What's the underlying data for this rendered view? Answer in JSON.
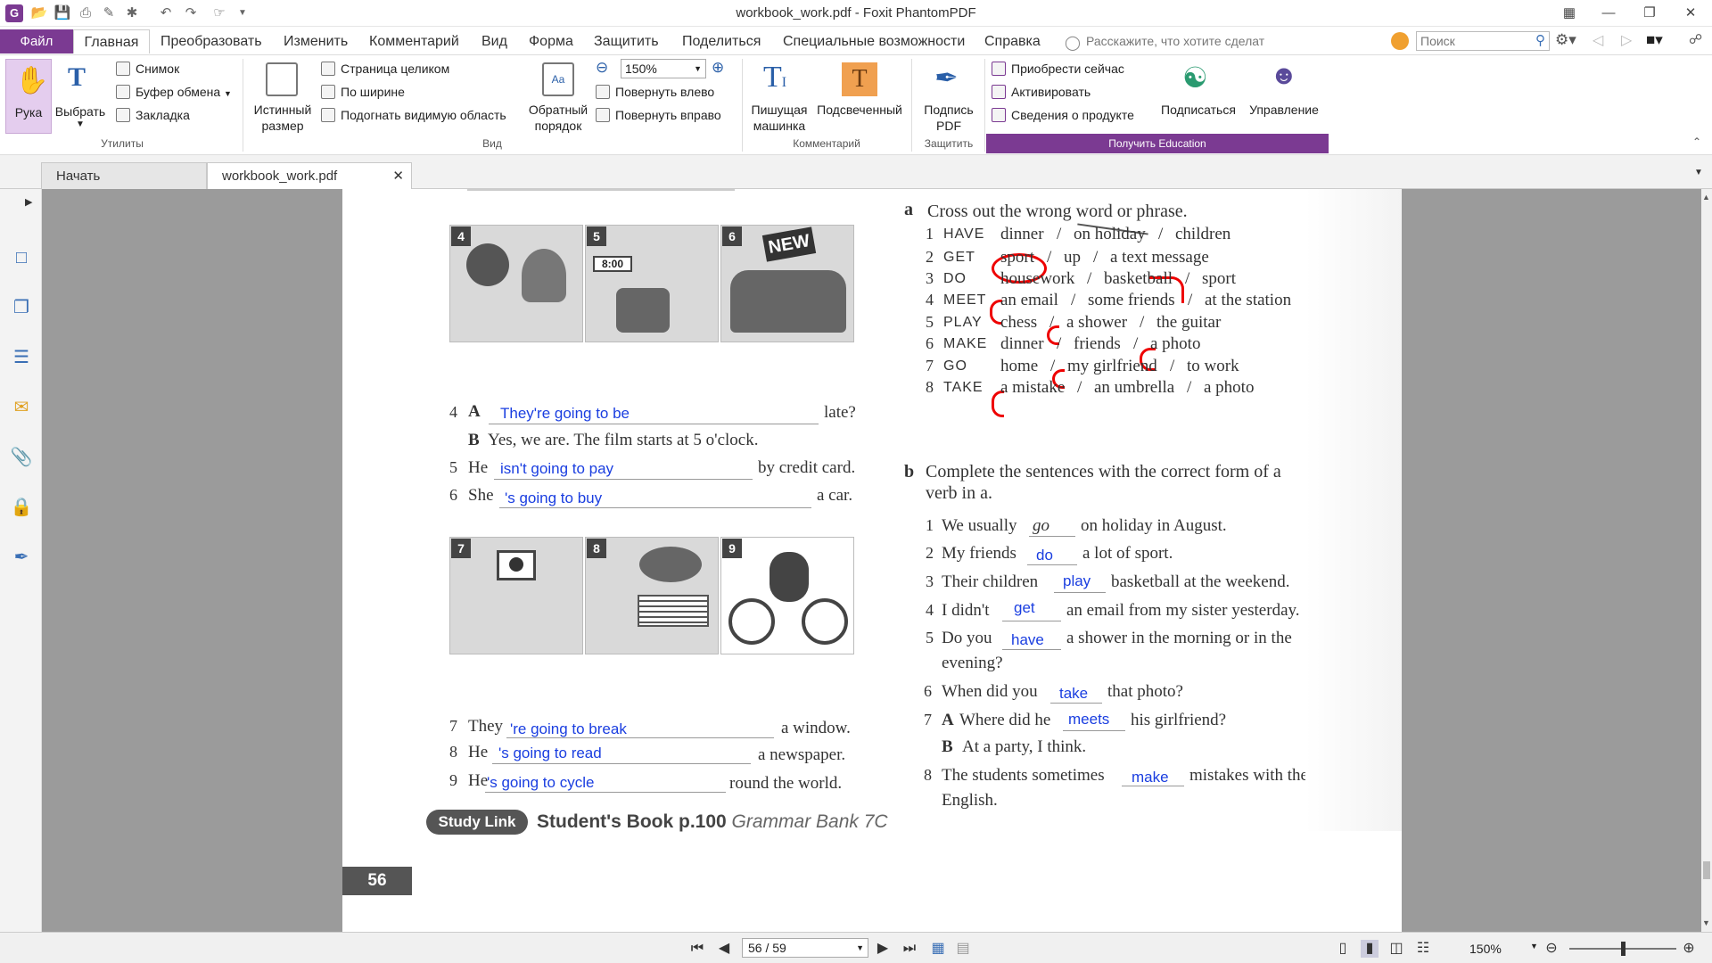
{
  "window": {
    "title": "workbook_work.pdf - Foxit PhantomPDF"
  },
  "menu": {
    "file": "Файл",
    "tabs": [
      "Главная",
      "Преобразовать",
      "Изменить",
      "Комментарий",
      "Вид",
      "Форма",
      "Защитить",
      "Поделиться",
      "Специальные возможности",
      "Справка"
    ],
    "tell_me": "Расскажите, что хотите сделат",
    "search_placeholder": "Поиск"
  },
  "ribbon": {
    "hand": "Рука",
    "select": "Выбрать",
    "snapshot": "Снимок",
    "clipboard": "Буфер обмена",
    "bookmark": "Закладка",
    "group_utilities": "Утилиты",
    "actual_size_1": "Истинный",
    "actual_size_2": "размер",
    "fit_page": "Страница целиком",
    "fit_width": "По ширине",
    "fit_visible": "Подогнать видимую область",
    "reverse_1": "Обратный",
    "reverse_2": "порядок",
    "zoom_value": "150%",
    "rotate_left": "Повернуть влево",
    "rotate_right": "Повернуть вправо",
    "group_view": "Вид",
    "typewriter_1": "Пишущая",
    "typewriter_2": "машинка",
    "highlight": "Подсвеченный",
    "group_comment": "Комментарий",
    "sign_1": "Подпись",
    "sign_2": "PDF",
    "group_protect": "Защитить",
    "buy_now": "Приобрести сейчас",
    "activate": "Активировать",
    "product_info": "Сведения о продукте",
    "subscribe": "Подписаться",
    "manage": "Управление",
    "get_education": "Получить Education"
  },
  "tabs": {
    "start": "Начать",
    "doc": "workbook_work.pdf"
  },
  "page": {
    "left": {
      "pic_numbers": [
        "4",
        "5",
        "6",
        "7",
        "8",
        "9"
      ],
      "clock": "8:00",
      "new_sign": "NEW",
      "line4": {
        "num": "4",
        "a": "A",
        "answer": "They're going to be",
        "end": "late?"
      },
      "line4b": {
        "b": "B",
        "text": "Yes, we are. The film starts at 5 o'clock."
      },
      "line5": {
        "num": "5",
        "start": "He",
        "answer": "isn't going to pay",
        "end": "by credit card."
      },
      "line6": {
        "num": "6",
        "start": "She",
        "answer": "'s going to buy",
        "end": "a car."
      },
      "line7": {
        "num": "7",
        "start": "They",
        "answer": "'re going to break",
        "end": "a window."
      },
      "line8": {
        "num": "8",
        "start": "He",
        "answer": "'s going to read",
        "end": "a newspaper."
      },
      "line9": {
        "num": "9",
        "start": "He",
        "answer": "'s going to cycle",
        "end": "round the world."
      },
      "study_link": "Study Link",
      "study_ref_bold": "Student's Book p.100",
      "study_ref_italic": "Grammar Bank 7C",
      "page_number": "56"
    },
    "right": {
      "a_letter": "a",
      "a_title": "Cross out the wrong word or phrase.",
      "rows": [
        {
          "n": "1",
          "verb": "HAVE",
          "w1": "dinner",
          "w2": "on holiday",
          "w3": "children"
        },
        {
          "n": "2",
          "verb": "GET",
          "w1": "sport",
          "w2": "up",
          "w3": "a text message"
        },
        {
          "n": "3",
          "verb": "DO",
          "w1": "housework",
          "w2": "basketball",
          "w3": "sport"
        },
        {
          "n": "4",
          "verb": "MEET",
          "w1": "an email",
          "w2": "some friends",
          "w3": "at the station"
        },
        {
          "n": "5",
          "verb": "PLAY",
          "w1": "chess",
          "w2": "a shower",
          "w3": "the guitar"
        },
        {
          "n": "6",
          "verb": "MAKE",
          "w1": "dinner",
          "w2": "friends",
          "w3": "a photo"
        },
        {
          "n": "7",
          "verb": "GO",
          "w1": "home",
          "w2": "my girlfriend",
          "w3": "to work"
        },
        {
          "n": "8",
          "verb": "TAKE",
          "w1": "a mistake",
          "w2": "an umbrella",
          "w3": "a photo"
        }
      ],
      "slash": "/",
      "b_letter": "b",
      "b_title_1": "Complete the sentences with the correct form of a",
      "b_title_2": "verb in a.",
      "s1": {
        "n": "1",
        "start": "We usually",
        "answer": "go",
        "end": "on holiday in August."
      },
      "s2": {
        "n": "2",
        "start": "My friends",
        "answer": "do",
        "end": "a lot of sport."
      },
      "s3": {
        "n": "3",
        "start": "Their children",
        "answer": "play",
        "end": "basketball at the weekend."
      },
      "s4": {
        "n": "4",
        "start": "I didn't",
        "answer": "get",
        "end": "an email from my sister yesterday."
      },
      "s5": {
        "n": "5",
        "start": "Do you",
        "answer": "have",
        "end": "a shower in the morning or in the",
        "cont": "evening?"
      },
      "s6": {
        "n": "6",
        "start": "When did you",
        "answer": "take",
        "end": "that photo?"
      },
      "s7": {
        "n": "7",
        "a": "A",
        "start": "Where did he",
        "answer": "meets",
        "end": "his girlfriend?",
        "b": "B",
        "b_text": "At a party, I think."
      },
      "s8": {
        "n": "8",
        "start": "The students sometimes",
        "answer": "make",
        "end": "mistakes with their",
        "cont": "English."
      }
    }
  },
  "status": {
    "page_input": "56 / 59",
    "zoom": "150%"
  },
  "colors": {
    "accent": "#7b3a92",
    "answer_blue": "#1a3ee0",
    "annotation_red": "#e00000"
  }
}
